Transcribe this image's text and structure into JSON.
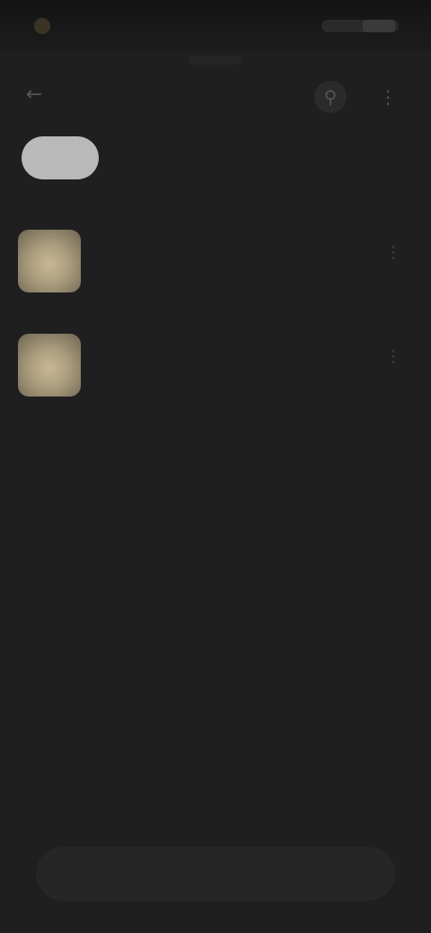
{
  "status_bar": {
    "time": "",
    "icons": [
      "network-icon",
      "wifi-icon",
      "battery-icon"
    ]
  },
  "header": {
    "back_icon": "arrow-left-icon",
    "title": "",
    "actions": [
      {
        "icon": "search-icon"
      },
      {
        "icon": "more-vertical-icon"
      }
    ]
  },
  "filter_chip": {
    "label": ""
  },
  "items": [
    {
      "title": "",
      "subtitle": "",
      "more_icon": "more-vertical-icon"
    },
    {
      "title": "",
      "subtitle": "",
      "more_icon": "more-vertical-icon"
    }
  ],
  "bottom_bar": {
    "label": ""
  },
  "colors": {
    "background": "#1f1f1f",
    "chip": "#b9b9b9",
    "thumbnail": "#c9b896"
  }
}
